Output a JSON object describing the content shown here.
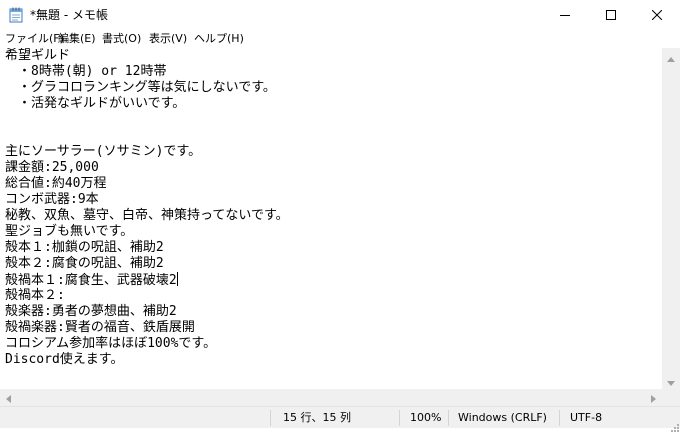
{
  "window": {
    "title": "*無題 - メモ帳"
  },
  "menu": {
    "file": "ファイル(F)",
    "edit": "編集(E)",
    "format": "書式(O)",
    "view": "表示(V)",
    "help": "ヘルプ(H)"
  },
  "editor": {
    "lines": [
      "希望ギルド",
      "　・8時帯(朝) or 12時帯",
      "　・グラコロランキング等は気にしないです。",
      "　・活発なギルドがいいです。",
      "",
      "",
      "主にソーサラー(ソサミン)です。",
      "課金額:25,000",
      "総合値:約40万程",
      "コンボ武器:9本",
      "秘教、双魚、墓守、白帝、神策持ってないです。",
      "聖ジョブも無いです。",
      "殻本１:枷鎖の呪詛、補助2",
      "殻本２:腐食の呪詛、補助2",
      "殻禍本１:腐食生、武器破壊2",
      "殻禍本２:",
      "殻楽器:勇者の夢想曲、補助2",
      "殻禍楽器:賢者の福音、鉄盾展開",
      "コロシアム参加率はほぼ100%です。",
      "Discord使えます。"
    ]
  },
  "status": {
    "position": "15 行、15 列",
    "zoom": "100%",
    "line_ending": "Windows (CRLF)",
    "encoding": "UTF-8"
  },
  "icons": {
    "app": "notepad-icon",
    "minimize": "minimize-icon",
    "maximize": "maximize-icon",
    "close": "close-icon"
  }
}
